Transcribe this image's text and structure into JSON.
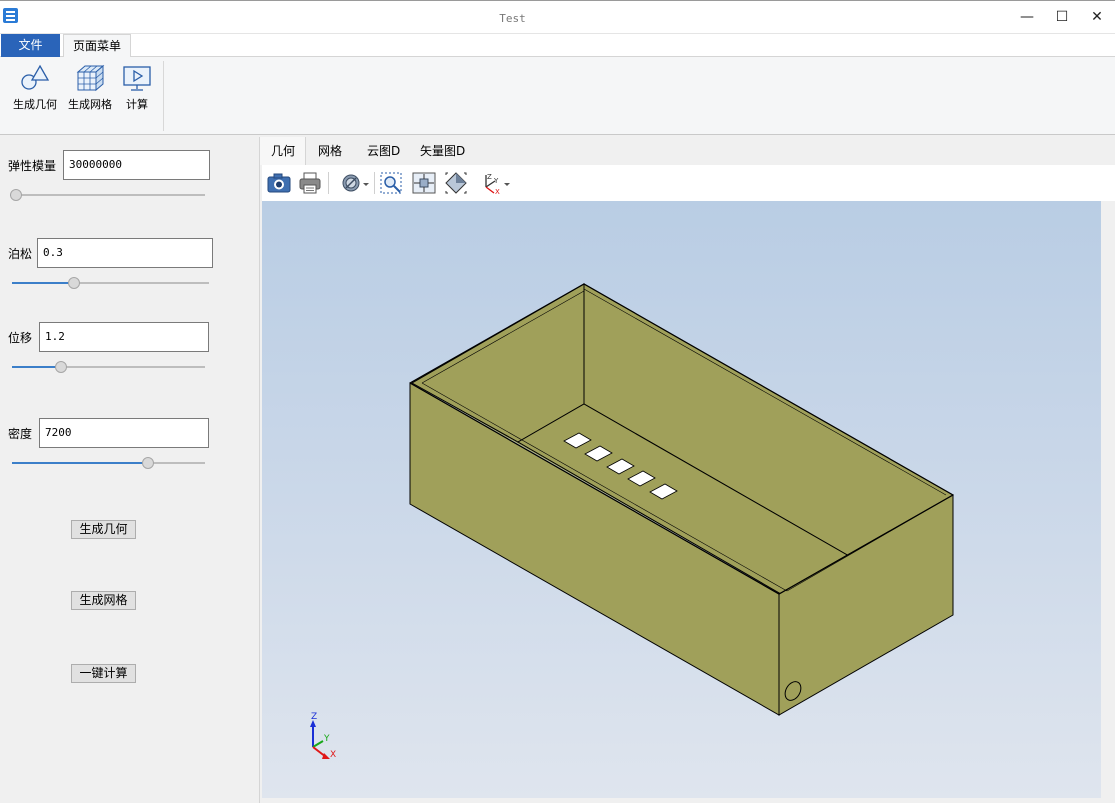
{
  "window": {
    "title": "Test",
    "minimize": "—",
    "maximize": "☐",
    "close": "✕"
  },
  "ribbon": {
    "tabs": [
      {
        "label": "文件"
      },
      {
        "label": "页面菜单"
      }
    ],
    "buttons": [
      {
        "label": "生成几何",
        "icon": "geometry-icon"
      },
      {
        "label": "生成网格",
        "icon": "mesh-icon"
      },
      {
        "label": "计算",
        "icon": "compute-icon"
      }
    ]
  },
  "params": {
    "elastic": {
      "label": "弹性模量",
      "value": "30000000",
      "slider": 0.0
    },
    "poisson": {
      "label": "泊松",
      "value": "0.3",
      "slider": 0.3
    },
    "displacement": {
      "label": "位移",
      "value": "1.2",
      "slider": 0.24
    },
    "density": {
      "label": "密度",
      "value": "7200",
      "slider": 0.72
    }
  },
  "actions": {
    "gen_geometry": "生成几何",
    "gen_mesh": "生成网格",
    "compute": "一键计算"
  },
  "view_tabs": [
    {
      "label": "几何"
    },
    {
      "label": "网格"
    },
    {
      "label": "云图D"
    },
    {
      "label": "矢量图D"
    }
  ],
  "toolbar": {
    "icons": [
      "camera-icon",
      "print-icon",
      "display-mode-icon",
      "zoom-box-icon",
      "fit-all-icon",
      "iso-view-icon",
      "axes-view-icon"
    ]
  },
  "viewport": {
    "model_color": "#a0a05a",
    "axis_labels": {
      "z": "Z",
      "y": "Y",
      "x": "X"
    }
  }
}
